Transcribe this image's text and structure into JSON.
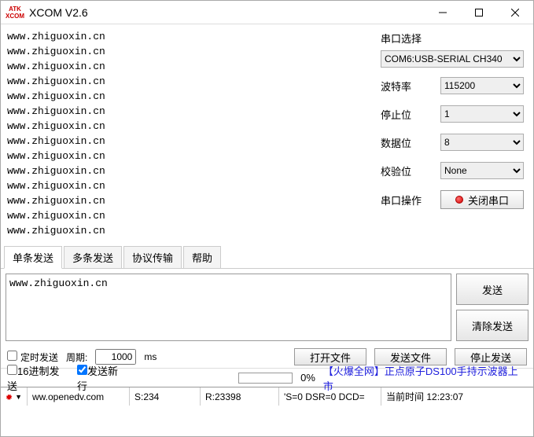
{
  "window": {
    "logo_top": "ATK",
    "logo_bottom": "XCOM",
    "title": "XCOM V2.6"
  },
  "recv_text": "www.zhiguoxin.cn\nwww.zhiguoxin.cn\nwww.zhiguoxin.cn\nwww.zhiguoxin.cn\nwww.zhiguoxin.cn\nwww.zhiguoxin.cn\nwww.zhiguoxin.cn\nwww.zhiguoxin.cn\nwww.zhiguoxin.cn\nwww.zhiguoxin.cn\nwww.zhiguoxin.cn\nwww.zhiguoxin.cn\nwww.zhiguoxin.cn\nwww.zhiguoxin.cn",
  "side": {
    "port_label": "串口选择",
    "port_value": "COM6:USB-SERIAL CH340",
    "baud_label": "波特率",
    "baud_value": "115200",
    "stop_label": "停止位",
    "stop_value": "1",
    "data_label": "数据位",
    "data_value": "8",
    "parity_label": "校验位",
    "parity_value": "None",
    "op_label": "串口操作",
    "op_btn": "关闭串口"
  },
  "tabs": {
    "t0": "单条发送",
    "t1": "多条发送",
    "t2": "协议传输",
    "t3": "帮助"
  },
  "send": {
    "text": "www.zhiguoxin.cn",
    "send_btn": "发送",
    "clear_btn": "清除发送"
  },
  "opt": {
    "timed": "定时发送",
    "period_label": "周期:",
    "period_value": "1000",
    "period_unit": "ms",
    "openfile": "打开文件",
    "sendfile": "发送文件",
    "stopsend": "停止发送",
    "hex": "16进制发送",
    "newline": "发送新行",
    "percent": "0%"
  },
  "ad": "【火爆全网】正点原子DS100手持示波器上市",
  "status": {
    "url": "ww.openedv.com",
    "s": "S:234",
    "r": "R:23398",
    "line": "'S=0 DSR=0 DCD=",
    "time_label": "当前时间",
    "time_value": "12:23:07"
  }
}
